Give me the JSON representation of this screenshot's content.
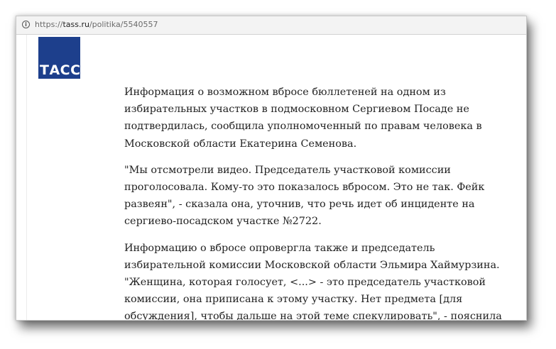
{
  "browser": {
    "url": {
      "scheme": "https://",
      "host": "tass.ru",
      "path": "/politika/5540557"
    },
    "info_icon": "i"
  },
  "site": {
    "logo_text": "ТАСС",
    "brand_color": "#1d3f8c"
  },
  "article": {
    "paragraphs": [
      "Информация о возможном вбросе бюллетеней на одном из избирательных участков в подмосковном Сергиевом Посаде не подтвердилась, сообщила уполномоченный по правам человека в Московской области Екатерина Семенова.",
      "\"Мы отсмотрели видео. Председатель участковой комиссии проголосовала. Кому-то это показалось вбросом. Это не так. Фейк развеян\", - сказала она, уточнив, что речь идет об инциденте на сергиево-посадском участке №2722.",
      "Информацию о вбросе опровергла также и председатель избирательной комиссии Московской области Эльмира Хаймурзина. \"Женщина, которая голосует, <...> - это председатель участковой комиссии, она приписана к этому участку. Нет предмета [для обсуждения], чтобы дальше на этой теме спекулировать\", - пояснила она."
    ]
  }
}
